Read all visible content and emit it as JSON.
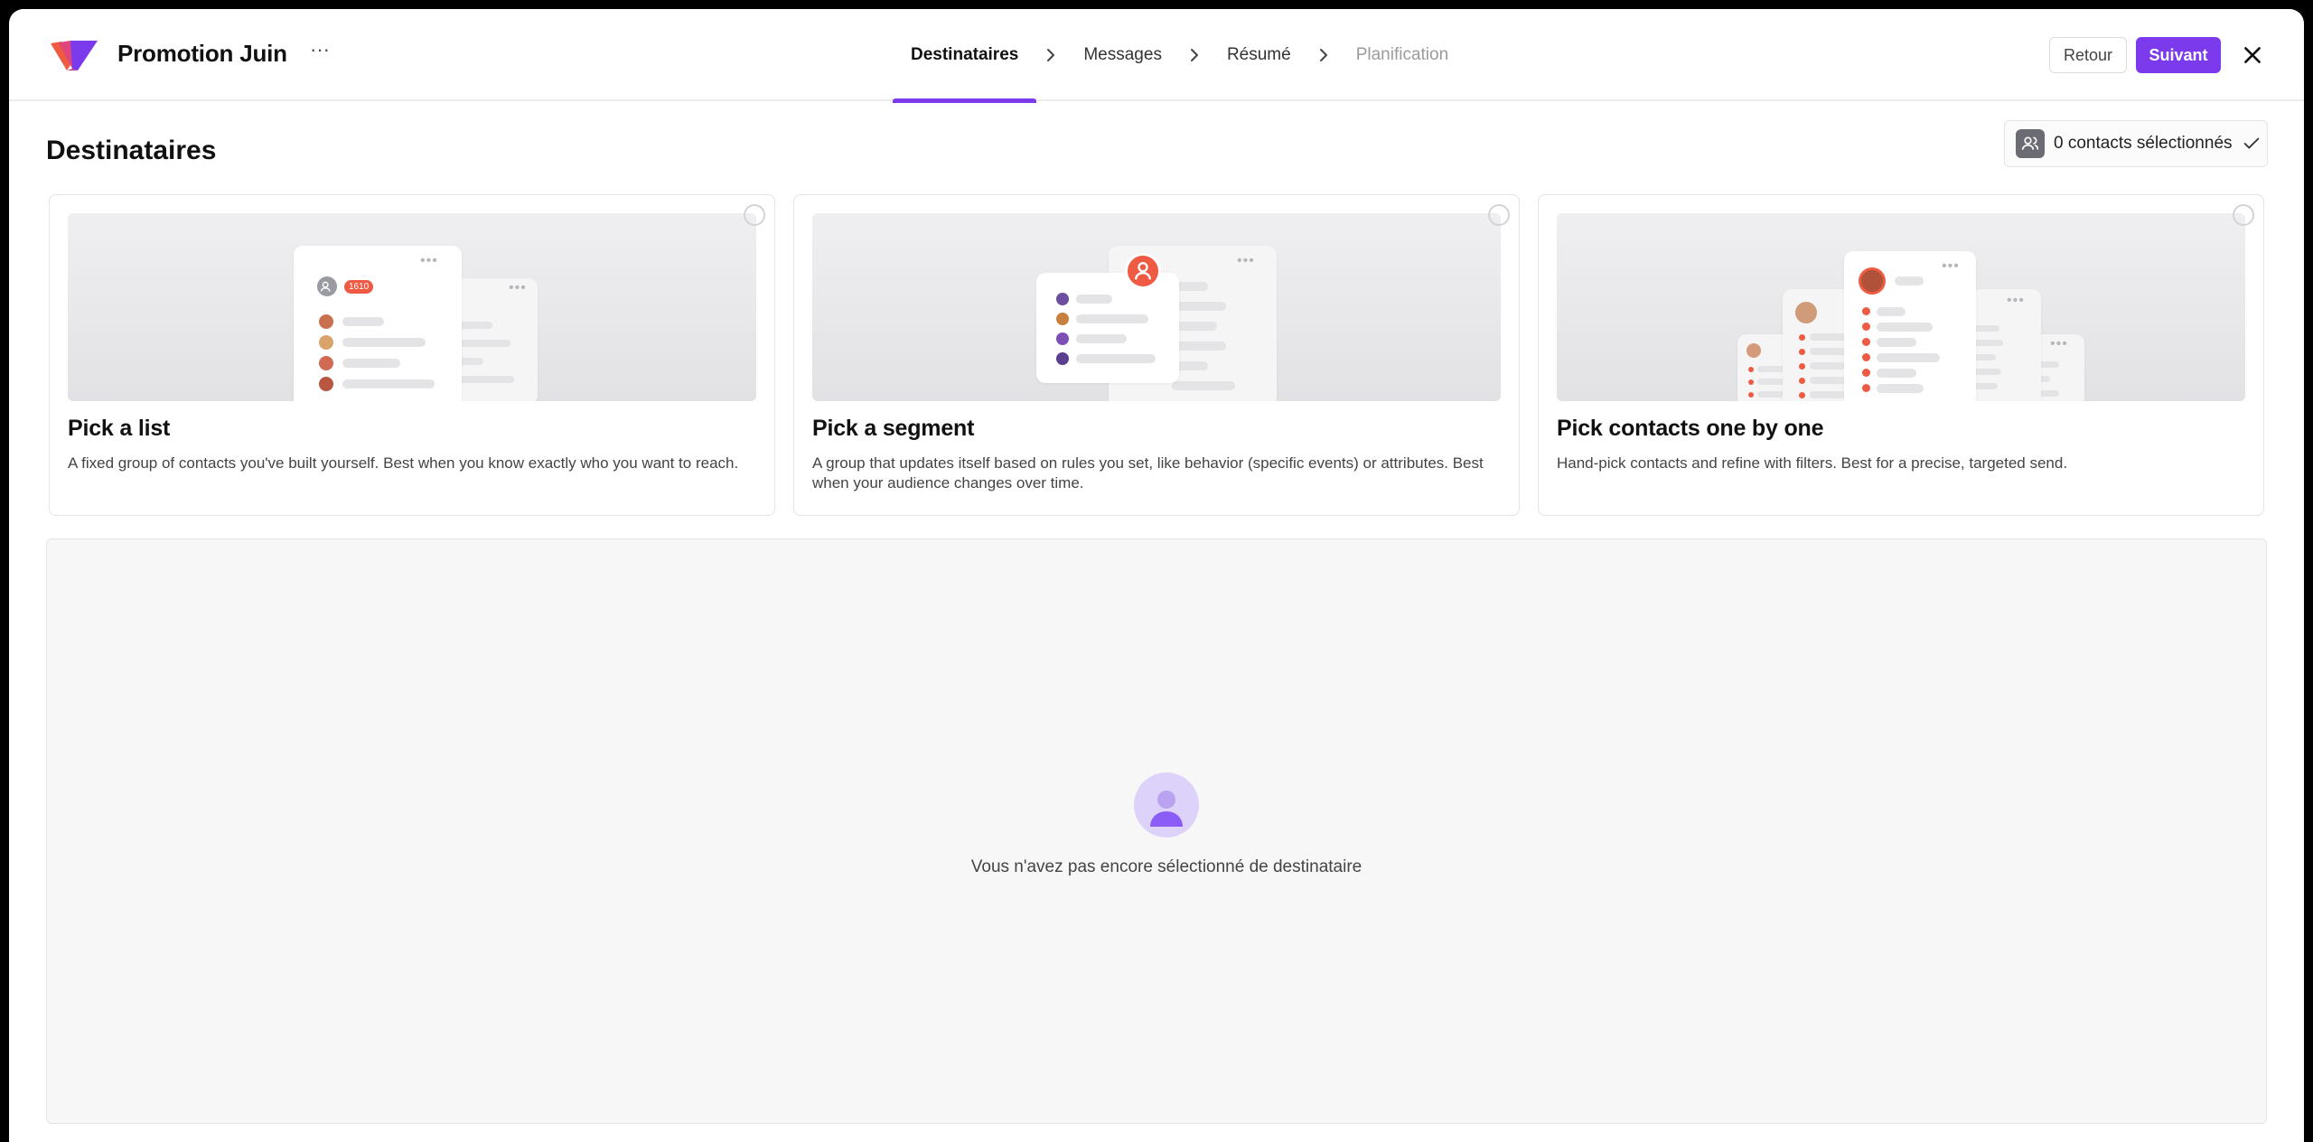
{
  "header": {
    "title": "Promotion Juin",
    "more_label": "···",
    "steps": [
      {
        "label": "Destinataires",
        "state": "active"
      },
      {
        "label": "Messages",
        "state": "default"
      },
      {
        "label": "Résumé",
        "state": "default"
      },
      {
        "label": "Planification",
        "state": "disabled"
      }
    ],
    "back_label": "Retour",
    "next_label": "Suivant"
  },
  "section": {
    "title": "Destinataires",
    "selected_contacts_label": "0 contacts sélectionnés"
  },
  "cards": [
    {
      "title": "Pick a list",
      "description": "A fixed group of contacts you've built yourself. Best when you know exactly who you want to reach.",
      "badge": "1610",
      "selected": false
    },
    {
      "title": "Pick a segment",
      "description": "A group that updates itself based on rules you set, like behavior (specific events) or attributes. Best when your audience changes over time.",
      "selected": false
    },
    {
      "title": "Pick contacts one by one",
      "description": "Hand-pick contacts and refine with filters. Best for a precise, targeted send.",
      "selected": false
    }
  ],
  "empty_state": {
    "text": "Vous n'avez pas encore sélectionné de destinataire"
  },
  "colors": {
    "accent": "#7c3aed",
    "brand_red": "#ef5a42",
    "empty_icon_bg": "#ddd2fa"
  },
  "icons": {
    "logo": "brand-logo",
    "more": "more-horizontal-icon",
    "step_separator": "chevron-right-icon",
    "close": "close-icon",
    "contacts": "users-icon",
    "check": "check-icon",
    "empty": "user-icon"
  }
}
